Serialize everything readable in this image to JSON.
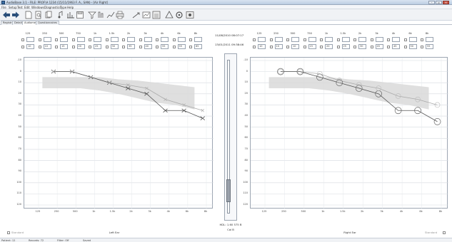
{
  "window": {
    "title": "AudioBase 3.1 - FILE: PROF\\A 1234 (15/11/1963 F. A., SAN) - [Air Right]"
  },
  "menu": [
    "File",
    "Setup",
    "Test",
    "Edit",
    "Windows",
    "Diagnostics",
    "Type",
    "Help"
  ],
  "tabs": [
    {
      "label": "Registry"
    },
    {
      "label": "Details"
    },
    {
      "label": "Audiometer",
      "active": true
    },
    {
      "label": "Questionnaires"
    }
  ],
  "thresholds": {
    "frequencies": [
      "125",
      "250",
      "500",
      "750",
      "1k",
      "1.5k",
      "2k",
      "3k",
      "4k",
      "6k",
      "8k"
    ],
    "left_row1": [
      "",
      "",
      "",
      "",
      "",
      "",
      "",
      "",
      "",
      "",
      ""
    ],
    "left_row2": [
      "10",
      "10",
      "15",
      "20",
      "25",
      "30",
      "35",
      "40",
      "55",
      "55",
      "65"
    ],
    "right_row1": [
      "",
      "",
      "",
      "",
      "",
      "",
      "",
      "",
      "",
      "",
      ""
    ],
    "right_row2": [
      "10",
      "10",
      "10",
      "15",
      "20",
      "25",
      "30",
      "45",
      "45",
      "50",
      "55"
    ]
  },
  "dates": {
    "date1": "11/08/2010 08:07:17",
    "date2": "13/01/2011 09:38:46"
  },
  "charts": {
    "y_ticks": [
      "-10",
      "0",
      "10",
      "20",
      "30",
      "40",
      "50",
      "60",
      "70",
      "80",
      "90",
      "100",
      "110",
      "120"
    ],
    "x_ticks": [
      "125",
      "250",
      "500",
      "1k",
      "1.5k",
      "2k",
      "3k",
      "4k",
      "6k",
      "8k"
    ],
    "left_label": "Left Ear",
    "right_label": "Right Ear",
    "left_curve_a": [
      0,
      0,
      5,
      10,
      15,
      20,
      35,
      35,
      42
    ],
    "left_curve_b": [
      0,
      0,
      5,
      10,
      12,
      15,
      25,
      30,
      35
    ],
    "right_curve_a": [
      0,
      0,
      5,
      10,
      15,
      20,
      35,
      35,
      45
    ],
    "right_curve_b": [
      0,
      0,
      2,
      8,
      12,
      15,
      22,
      25,
      30
    ],
    "accent": "#555555",
    "band": "#d9d9d9"
  },
  "middle": {
    "hl_text": "HDL: 1.60  575 B",
    "cal_text": "Cal B"
  },
  "standard_left": "Standard",
  "standard_right": "Standard",
  "status": {
    "patient": "Patient: 12",
    "records": "Records: 72",
    "filter": "Filter: Off",
    "state": "Saved"
  }
}
